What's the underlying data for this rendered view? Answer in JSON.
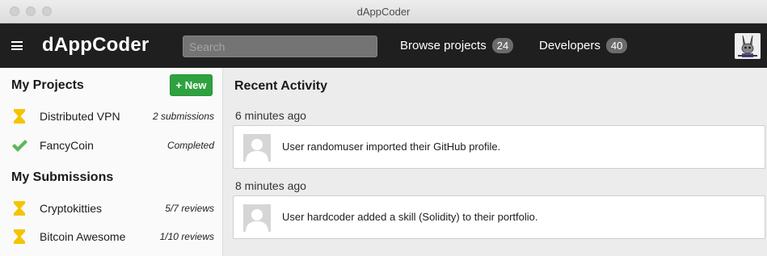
{
  "window": {
    "title": "dAppCoder"
  },
  "navbar": {
    "brand": "dAppCoder",
    "search_placeholder": "Search",
    "browse_label": "Browse projects",
    "browse_count": "24",
    "developers_label": "Developers",
    "developers_count": "40"
  },
  "sidebar": {
    "projects_title": "My Projects",
    "new_label": "+ New",
    "projects": [
      {
        "name": "Distributed VPN",
        "meta": "2 submissions",
        "icon": "hourglass-icon"
      },
      {
        "name": "FancyCoin",
        "meta": "Completed",
        "icon": "check-icon"
      }
    ],
    "submissions_title": "My Submissions",
    "submissions": [
      {
        "name": "Cryptokitties",
        "meta": "5/7 reviews",
        "icon": "hourglass-icon"
      },
      {
        "name": "Bitcoin Awesome",
        "meta": "1/10 reviews",
        "icon": "hourglass-icon"
      }
    ]
  },
  "main": {
    "title": "Recent Activity",
    "activities": [
      {
        "time": "6 minutes ago",
        "text": "User randomuser imported their GitHub profile."
      },
      {
        "time": "8 minutes ago",
        "text": "User hardcoder added a skill (Solidity) to their portfolio."
      }
    ]
  },
  "colors": {
    "navbar_bg": "#1f1f1f",
    "accent_green": "#2fa23f",
    "hourglass": "#f5c400",
    "check": "#5cb85c"
  }
}
